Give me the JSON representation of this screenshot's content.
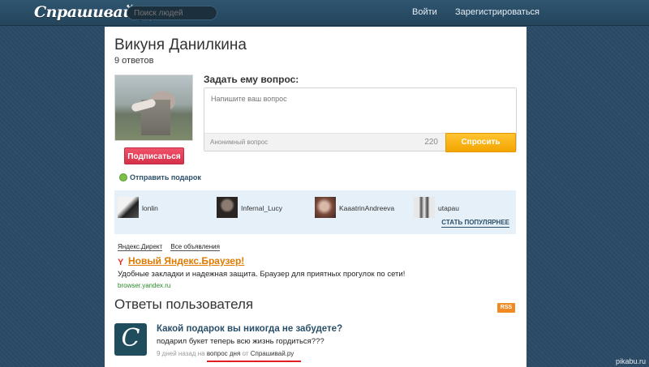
{
  "header": {
    "logo": "Спрашивай.ру",
    "search_placeholder": "Поиск людей",
    "login": "Войти",
    "register": "Зарегистрироваться"
  },
  "profile": {
    "name": "Викуня Данилкина",
    "answers_count": "9 ответов",
    "subscribe_label": "Подписаться",
    "gift_label": "Отправить подарок"
  },
  "ask": {
    "label": "Задать ему вопрос:",
    "placeholder": "Напишите ваш вопрос",
    "anonymous_label": "Анонимный вопрос",
    "char_counter": "220",
    "submit_label": "Спросить"
  },
  "popular": {
    "users": [
      {
        "name": "lonlin"
      },
      {
        "name": "Infernal_Lucy"
      },
      {
        "name": "KaaatrinAndreeva"
      },
      {
        "name": "utapau"
      }
    ],
    "become_popular": "СТАТЬ ПОПУЛЯРНЕЕ"
  },
  "ads": {
    "direct_label": "Яндекс.Директ",
    "all_ads_label": "Все объявления",
    "title": "Новый Яндекс.Браузер!",
    "text": "Удобные закладки и надежная защита. Браузер для приятных прогулок по сети!",
    "url": "browser.yandex.ru"
  },
  "answers": {
    "section_title": "Ответы пользователя",
    "rss_label": "RSS",
    "items": [
      {
        "question": "Какой подарок вы никогда не забудете?",
        "answer": "подарил букет теперь всю жизнь гордиться???",
        "time": "9 дней назад",
        "on_word": "на",
        "source_type": "вопрос дня",
        "from_word": "от",
        "source_site": "Спрашивай.ру"
      }
    ]
  },
  "watermark": "pikabu.ru",
  "colors": {
    "accent_orange": "#f3a500",
    "subscribe_red": "#d6304a",
    "link_blue": "#2a4f6a"
  }
}
